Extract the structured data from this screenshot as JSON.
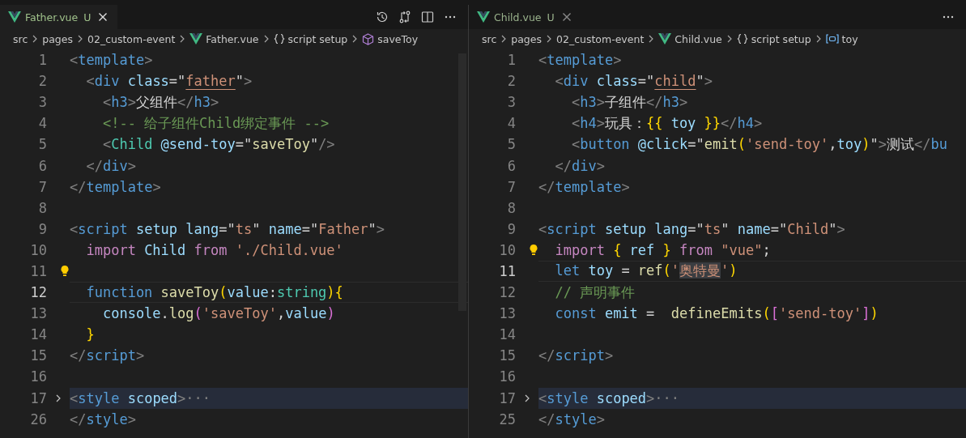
{
  "panes": [
    {
      "tab": {
        "label": "Father.vue",
        "status": "U",
        "selected": true
      },
      "breadcrumbs": [
        {
          "label": "src",
          "kind": "folder"
        },
        {
          "label": "pages",
          "kind": "folder"
        },
        {
          "label": "02_custom-event",
          "kind": "folder"
        },
        {
          "label": "Father.vue",
          "kind": "vue"
        },
        {
          "label": "script setup",
          "kind": "braces"
        },
        {
          "label": "saveToy",
          "kind": "method"
        }
      ],
      "lines": [
        {
          "number": "1",
          "current": false,
          "tokens": [
            {
              "text": "<",
              "kind": "p"
            },
            {
              "text": "template",
              "kind": "tag"
            },
            {
              "text": ">",
              "kind": "p"
            }
          ]
        },
        {
          "number": "2",
          "current": false,
          "tokens": [
            {
              "text": "  <",
              "kind": "p"
            },
            {
              "text": "div",
              "kind": "tag"
            },
            {
              "text": " class",
              "kind": "attr"
            },
            {
              "text": "=\"",
              "kind": "txt"
            },
            {
              "text": "father",
              "kind": "strref"
            },
            {
              "text": "\"",
              "kind": "txt"
            },
            {
              "text": ">",
              "kind": "p"
            }
          ]
        },
        {
          "number": "3",
          "current": false,
          "tokens": [
            {
              "text": "    <",
              "kind": "p"
            },
            {
              "text": "h3",
              "kind": "tag"
            },
            {
              "text": ">",
              "kind": "p"
            },
            {
              "text": "父组件",
              "kind": "txt"
            },
            {
              "text": "</",
              "kind": "p"
            },
            {
              "text": "h3",
              "kind": "tag"
            },
            {
              "text": ">",
              "kind": "p"
            }
          ]
        },
        {
          "number": "4",
          "current": false,
          "tokens": [
            {
              "text": "    <!-- 给子组件Child绑定事件 -->",
              "kind": "comment"
            }
          ]
        },
        {
          "number": "5",
          "current": false,
          "tokens": [
            {
              "text": "    <",
              "kind": "p"
            },
            {
              "text": "Child",
              "kind": "type"
            },
            {
              "text": " @send-toy",
              "kind": "attr"
            },
            {
              "text": "=\"",
              "kind": "txt"
            },
            {
              "text": "saveToy",
              "kind": "func"
            },
            {
              "text": "\"",
              "kind": "txt"
            },
            {
              "text": "/>",
              "kind": "p"
            }
          ]
        },
        {
          "number": "6",
          "current": false,
          "tokens": [
            {
              "text": "  </",
              "kind": "p"
            },
            {
              "text": "div",
              "kind": "tag"
            },
            {
              "text": ">",
              "kind": "p"
            }
          ]
        },
        {
          "number": "7",
          "current": false,
          "tokens": [
            {
              "text": "</",
              "kind": "p"
            },
            {
              "text": "template",
              "kind": "tag"
            },
            {
              "text": ">",
              "kind": "p"
            }
          ]
        },
        {
          "number": "8",
          "current": false
        },
        {
          "number": "9",
          "current": false,
          "tokens": [
            {
              "text": "<",
              "kind": "p"
            },
            {
              "text": "script",
              "kind": "tag"
            },
            {
              "text": " setup lang",
              "kind": "attr"
            },
            {
              "text": "=\"",
              "kind": "txt"
            },
            {
              "text": "ts",
              "kind": "str"
            },
            {
              "text": "\"",
              "kind": "txt"
            },
            {
              "text": " name",
              "kind": "attr"
            },
            {
              "text": "=\"",
              "kind": "txt"
            },
            {
              "text": "Father",
              "kind": "str"
            },
            {
              "text": "\"",
              "kind": "txt"
            },
            {
              "text": ">",
              "kind": "p"
            }
          ]
        },
        {
          "number": "10",
          "current": false,
          "tokens": [
            {
              "text": "  import",
              "kind": "kw"
            },
            {
              "text": " Child ",
              "kind": "var"
            },
            {
              "text": "from",
              "kind": "kw"
            },
            {
              "text": " './Child.vue'",
              "kind": "str"
            }
          ]
        },
        {
          "number": "11",
          "current": false,
          "lightbulb": true
        },
        {
          "number": "12",
          "current": true,
          "tokens": [
            {
              "text": "  function",
              "kind": "decl"
            },
            {
              "text": " saveToy",
              "kind": "func"
            },
            {
              "text": "(",
              "kind": "brace"
            },
            {
              "text": "value",
              "kind": "var"
            },
            {
              "text": ":",
              "kind": "txt"
            },
            {
              "text": "string",
              "kind": "type"
            },
            {
              "text": ")",
              "kind": "brace"
            },
            {
              "text": "{",
              "kind": "brace"
            }
          ]
        },
        {
          "number": "13",
          "current": false,
          "tokens": [
            {
              "text": "    console",
              "kind": "var"
            },
            {
              "text": ".",
              "kind": "txt"
            },
            {
              "text": "log",
              "kind": "func"
            },
            {
              "text": "(",
              "kind": "paren2"
            },
            {
              "text": "'saveToy'",
              "kind": "str"
            },
            {
              "text": ",",
              "kind": "txt"
            },
            {
              "text": "value",
              "kind": "var"
            },
            {
              "text": ")",
              "kind": "paren2"
            }
          ]
        },
        {
          "number": "14",
          "current": false,
          "tokens": [
            {
              "text": "  }",
              "kind": "brace"
            }
          ]
        },
        {
          "number": "15",
          "current": false,
          "tokens": [
            {
              "text": "</",
              "kind": "p"
            },
            {
              "text": "script",
              "kind": "tag"
            },
            {
              "text": ">",
              "kind": "p"
            }
          ]
        },
        {
          "number": "16",
          "current": false
        },
        {
          "number": "17",
          "current": false,
          "folded": true,
          "tokens": [
            {
              "text": "<",
              "kind": "p"
            },
            {
              "text": "style",
              "kind": "tag"
            },
            {
              "text": " scoped",
              "kind": "attr"
            },
            {
              "text": ">",
              "kind": "p"
            },
            {
              "text": "···",
              "kind": "p"
            }
          ]
        },
        {
          "number": "26",
          "current": false,
          "tokens": [
            {
              "text": "</",
              "kind": "p"
            },
            {
              "text": "style",
              "kind": "tag"
            },
            {
              "text": ">",
              "kind": "p"
            }
          ]
        }
      ]
    },
    {
      "tab": {
        "label": "Child.vue",
        "status": "U",
        "selected": false
      },
      "breadcrumbs": [
        {
          "label": "src",
          "kind": "folder"
        },
        {
          "label": "pages",
          "kind": "folder"
        },
        {
          "label": "02_custom-event",
          "kind": "folder"
        },
        {
          "label": "Child.vue",
          "kind": "vue"
        },
        {
          "label": "script setup",
          "kind": "braces"
        },
        {
          "label": "toy",
          "kind": "variable"
        }
      ],
      "lines": [
        {
          "number": "1",
          "current": false,
          "tokens": [
            {
              "text": "<",
              "kind": "p"
            },
            {
              "text": "template",
              "kind": "tag"
            },
            {
              "text": ">",
              "kind": "p"
            }
          ]
        },
        {
          "number": "2",
          "current": false,
          "tokens": [
            {
              "text": "  <",
              "kind": "p"
            },
            {
              "text": "div",
              "kind": "tag"
            },
            {
              "text": " class",
              "kind": "attr"
            },
            {
              "text": "=\"",
              "kind": "txt"
            },
            {
              "text": "child",
              "kind": "strref"
            },
            {
              "text": "\"",
              "kind": "txt"
            },
            {
              "text": ">",
              "kind": "p"
            }
          ]
        },
        {
          "number": "3",
          "current": false,
          "tokens": [
            {
              "text": "    <",
              "kind": "p"
            },
            {
              "text": "h3",
              "kind": "tag"
            },
            {
              "text": ">",
              "kind": "p"
            },
            {
              "text": "子组件",
              "kind": "txt"
            },
            {
              "text": "</",
              "kind": "p"
            },
            {
              "text": "h3",
              "kind": "tag"
            },
            {
              "text": ">",
              "kind": "p"
            }
          ]
        },
        {
          "number": "4",
          "current": false,
          "tokens": [
            {
              "text": "    <",
              "kind": "p"
            },
            {
              "text": "h4",
              "kind": "tag"
            },
            {
              "text": ">",
              "kind": "p"
            },
            {
              "text": "玩具：",
              "kind": "txt"
            },
            {
              "text": "{{",
              "kind": "brace"
            },
            {
              "text": " toy ",
              "kind": "var"
            },
            {
              "text": "}}",
              "kind": "brace"
            },
            {
              "text": "</",
              "kind": "p"
            },
            {
              "text": "h4",
              "kind": "tag"
            },
            {
              "text": ">",
              "kind": "p"
            }
          ]
        },
        {
          "number": "5",
          "current": false,
          "tokens": [
            {
              "text": "    <",
              "kind": "p"
            },
            {
              "text": "button",
              "kind": "tag"
            },
            {
              "text": " @click",
              "kind": "attr"
            },
            {
              "text": "=\"",
              "kind": "txt"
            },
            {
              "text": "emit",
              "kind": "func"
            },
            {
              "text": "(",
              "kind": "brace"
            },
            {
              "text": "'send-toy'",
              "kind": "str"
            },
            {
              "text": ",",
              "kind": "txt"
            },
            {
              "text": "toy",
              "kind": "var"
            },
            {
              "text": ")",
              "kind": "brace"
            },
            {
              "text": "\"",
              "kind": "txt"
            },
            {
              "text": ">",
              "kind": "p"
            },
            {
              "text": "测试",
              "kind": "txt"
            },
            {
              "text": "</",
              "kind": "p"
            },
            {
              "text": "bu",
              "kind": "tag"
            }
          ]
        },
        {
          "number": "6",
          "current": false,
          "tokens": [
            {
              "text": "  </",
              "kind": "p"
            },
            {
              "text": "div",
              "kind": "tag"
            },
            {
              "text": ">",
              "kind": "p"
            }
          ]
        },
        {
          "number": "7",
          "current": false,
          "tokens": [
            {
              "text": "</",
              "kind": "p"
            },
            {
              "text": "template",
              "kind": "tag"
            },
            {
              "text": ">",
              "kind": "p"
            }
          ]
        },
        {
          "number": "8",
          "current": false
        },
        {
          "number": "9",
          "current": false,
          "tokens": [
            {
              "text": "<",
              "kind": "p"
            },
            {
              "text": "script",
              "kind": "tag"
            },
            {
              "text": " setup lang",
              "kind": "attr"
            },
            {
              "text": "=\"",
              "kind": "txt"
            },
            {
              "text": "ts",
              "kind": "str"
            },
            {
              "text": "\"",
              "kind": "txt"
            },
            {
              "text": " name",
              "kind": "attr"
            },
            {
              "text": "=\"",
              "kind": "txt"
            },
            {
              "text": "Child",
              "kind": "str"
            },
            {
              "text": "\"",
              "kind": "txt"
            },
            {
              "text": ">",
              "kind": "p"
            }
          ]
        },
        {
          "number": "10",
          "current": false,
          "lightbulb": true,
          "tokens": [
            {
              "text": "  import",
              "kind": "kw"
            },
            {
              "text": " {",
              "kind": "brace"
            },
            {
              "text": " ref ",
              "kind": "var"
            },
            {
              "text": "}",
              "kind": "brace"
            },
            {
              "text": " from",
              "kind": "kw"
            },
            {
              "text": " \"vue\"",
              "kind": "str"
            },
            {
              "text": ";",
              "kind": "txt"
            }
          ]
        },
        {
          "number": "11",
          "current": true,
          "tokens": [
            {
              "text": "  let",
              "kind": "decl"
            },
            {
              "text": " toy ",
              "kind": "var"
            },
            {
              "text": "= ",
              "kind": "txt"
            },
            {
              "text": "ref",
              "kind": "func"
            },
            {
              "text": "(",
              "kind": "brace"
            },
            {
              "text": "'",
              "kind": "str"
            },
            {
              "text": "奥特曼",
              "kind": "strsel"
            },
            {
              "text": "'",
              "kind": "str"
            },
            {
              "text": ")",
              "kind": "brace"
            }
          ]
        },
        {
          "number": "12",
          "current": false,
          "tokens": [
            {
              "text": "  // 声明事件",
              "kind": "comment"
            }
          ]
        },
        {
          "number": "13",
          "current": false,
          "tokens": [
            {
              "text": "  const",
              "kind": "decl"
            },
            {
              "text": " emit ",
              "kind": "var"
            },
            {
              "text": "=  ",
              "kind": "txt"
            },
            {
              "text": "defineEmits",
              "kind": "func"
            },
            {
              "text": "(",
              "kind": "brace"
            },
            {
              "text": "[",
              "kind": "paren2"
            },
            {
              "text": "'send-toy'",
              "kind": "str"
            },
            {
              "text": "]",
              "kind": "paren2"
            },
            {
              "text": ")",
              "kind": "brace"
            }
          ]
        },
        {
          "number": "14",
          "current": false
        },
        {
          "number": "15",
          "current": false,
          "tokens": [
            {
              "text": "</",
              "kind": "p"
            },
            {
              "text": "script",
              "kind": "tag"
            },
            {
              "text": ">",
              "kind": "p"
            }
          ]
        },
        {
          "number": "16",
          "current": false
        },
        {
          "number": "17",
          "current": false,
          "folded": true,
          "tokens": [
            {
              "text": "<",
              "kind": "p"
            },
            {
              "text": "style",
              "kind": "tag"
            },
            {
              "text": " scoped",
              "kind": "attr"
            },
            {
              "text": ">",
              "kind": "p"
            },
            {
              "text": "···",
              "kind": "p"
            }
          ]
        },
        {
          "number": "25",
          "current": false,
          "tokens": [
            {
              "text": "</",
              "kind": "p"
            },
            {
              "text": "style",
              "kind": "tag"
            },
            {
              "text": ">",
              "kind": "p"
            }
          ]
        }
      ]
    }
  ]
}
